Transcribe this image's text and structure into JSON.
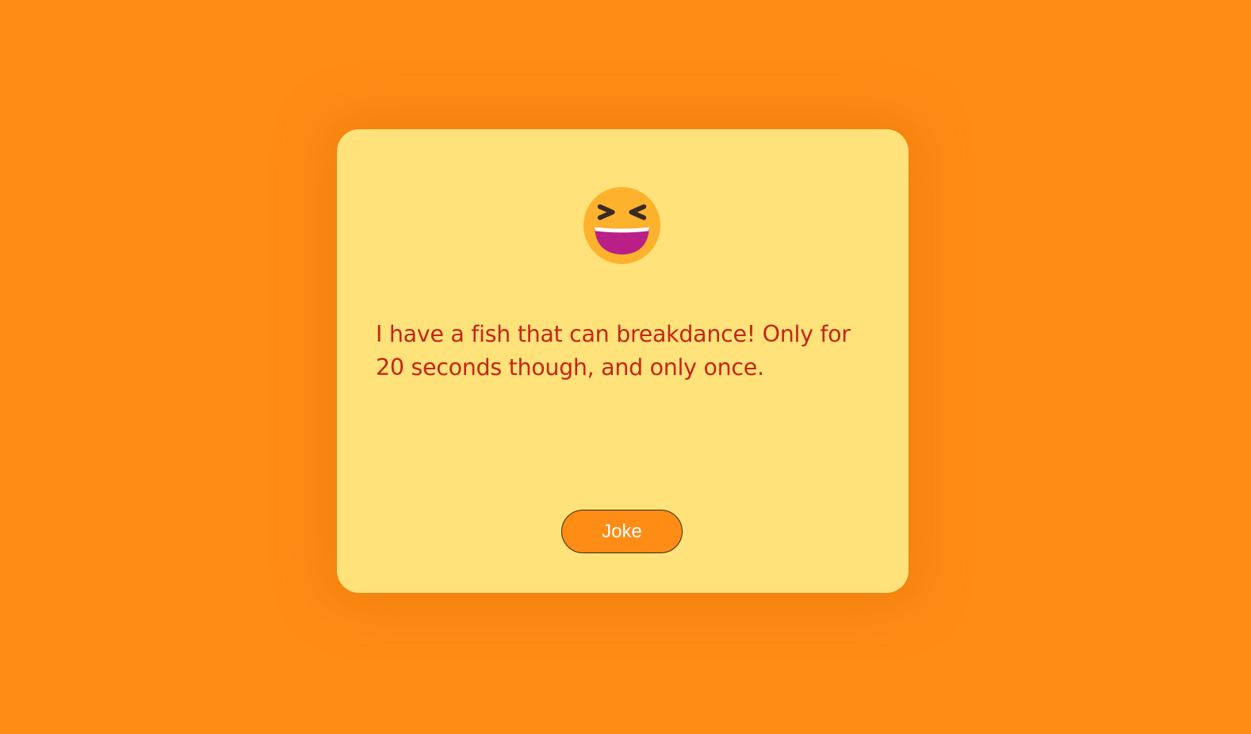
{
  "joke": {
    "text": "I have a fish that can breakdance! Only for 20 seconds though, and only once."
  },
  "button": {
    "label": "Joke"
  },
  "icon": {
    "name": "grinning-squinting-face-icon"
  },
  "colors": {
    "background": "#fe8c15",
    "card": "#ffe279",
    "text": "#c4261a",
    "button": "#fe8c15",
    "button_text": "#ffffff"
  }
}
